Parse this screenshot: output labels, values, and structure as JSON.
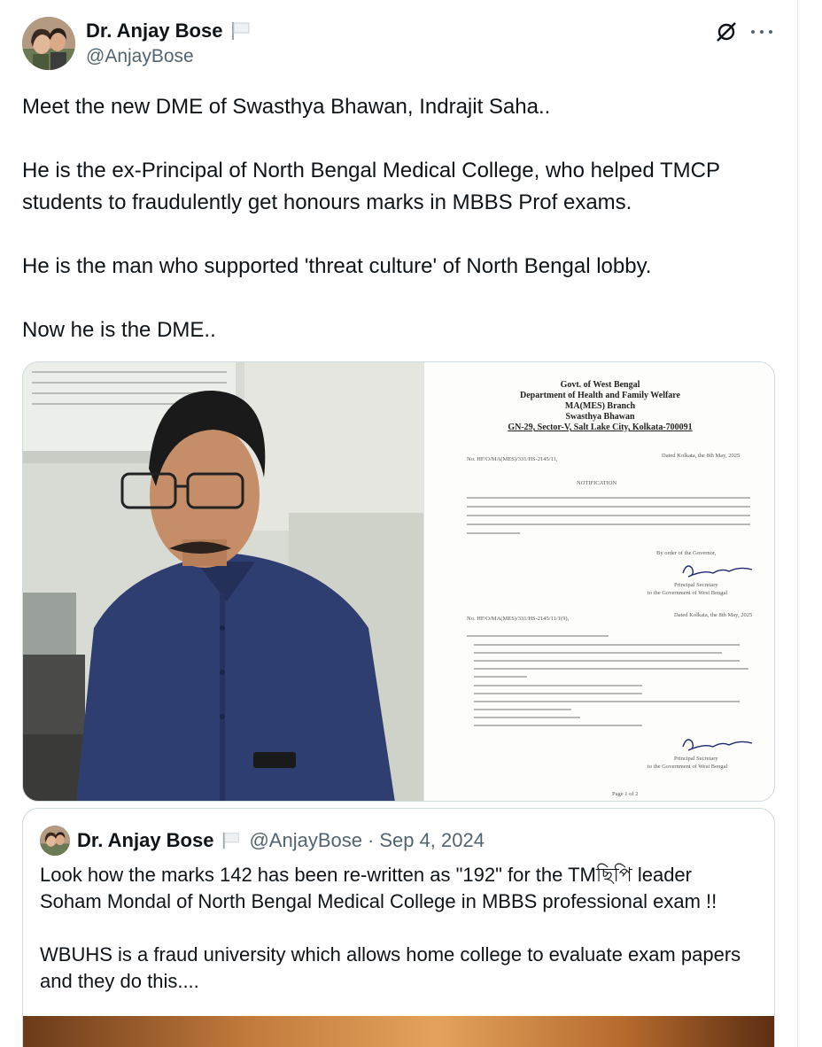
{
  "tweet": {
    "author_name": "Dr. Anjay Bose",
    "author_handle": "@AnjayBose",
    "paragraphs": [
      "Meet the new DME of Swasthya Bhawan, Indrajit Saha..",
      "He is the ex-Principal of North Bengal Medical College, who helped TMCP students to fraudulently get honours marks in MBBS Prof exams.",
      "He is the man who supported 'threat culture' of North Bengal lobby.",
      "Now he is the DME.."
    ],
    "icons": [
      "flag-icon",
      "grok-icon",
      "more-icon"
    ]
  },
  "document": {
    "header": [
      "Govt. of West Bengal",
      "Department of Health and Family Welfare",
      "MA(MES) Branch",
      "Swasthya Bhawan",
      "GN-29, Sector-V, Salt Lake City, Kolkata-700091"
    ],
    "memo_no": "No. HF/O/MA(MES)/331/HS-2145/11,",
    "dated": "Dated Kolkata, the 8th May, 2025",
    "title": "NOTIFICATION",
    "signatory": "Principal Secretary",
    "signatory_org": "to the Government of West Bengal",
    "order_line": "By order of the Governor,",
    "memo_no_2": "No. HF/O/MA(MES)/331/HS-2145/11/1(9),",
    "dated_2": "Dated Kolkata, the 8th May, 2025",
    "page": "Page 1 of 2"
  },
  "quote": {
    "author_name": "Dr. Anjay Bose",
    "author_handle": "@AnjayBose",
    "date": "Sep 4, 2024",
    "separator": "·",
    "text_1": "Look how the marks 142 has been re-written as \"192\" for the TMছিপি leader Soham Mondal of North Bengal Medical College in MBBS professional exam !!",
    "text_2": "WBUHS is a fraud university which allows home college to evaluate exam papers and they do this...."
  }
}
